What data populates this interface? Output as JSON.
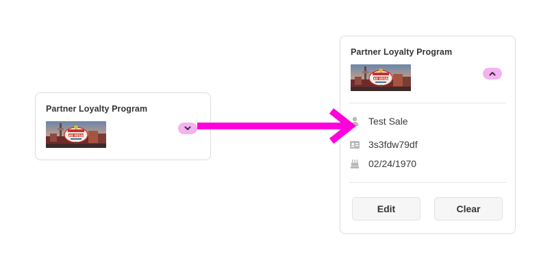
{
  "collapsed_card": {
    "title": "Partner Loyalty Program",
    "image": "las-vegas-sign-thumbnail",
    "toggle_icon": "chevron-down-icon"
  },
  "expanded_card": {
    "title": "Partner Loyalty Program",
    "image": "las-vegas-sign-thumbnail",
    "toggle_icon": "chevron-up-icon",
    "details": [
      {
        "icon": "person-icon",
        "text": "Test Sale"
      },
      {
        "icon": "id-card-icon",
        "text": "3s3fdw79df"
      },
      {
        "icon": "birthday-cake-icon",
        "text": "02/24/1970"
      }
    ],
    "buttons": {
      "edit_label": "Edit",
      "clear_label": "Clear"
    }
  },
  "colors": {
    "arrow": "#ff00dc",
    "toggle_bg": "#f4b2f0",
    "card_border": "#dcdcdc",
    "icon_gray": "#b8b8b8"
  }
}
